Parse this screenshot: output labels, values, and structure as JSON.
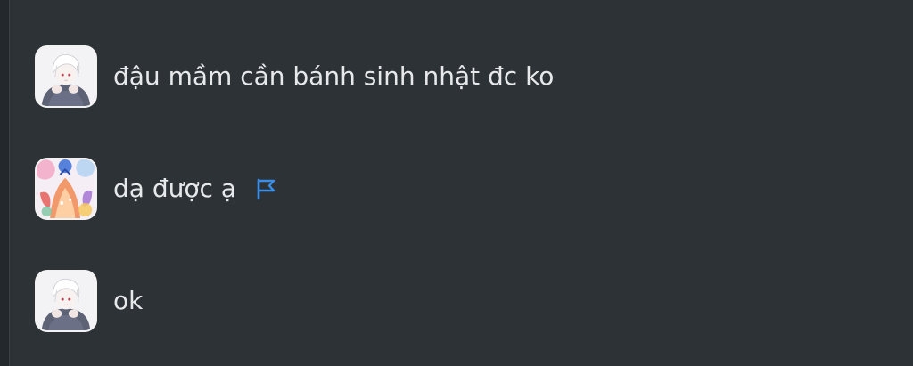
{
  "chat": {
    "messages": [
      {
        "text": "đậu mầm cần bánh sinh nhật đc ko",
        "avatar_icon": "white-hair-boy-avatar"
      },
      {
        "text": "dạ được ạ",
        "avatar_icon": "colorful-art-avatar",
        "status_icon": "flag-icon"
      },
      {
        "text": "ok",
        "avatar_icon": "white-hair-boy-avatar"
      }
    ]
  },
  "colors": {
    "background": "#2d3236",
    "text": "#e6e8ea",
    "flag": "#3b8ee8"
  }
}
